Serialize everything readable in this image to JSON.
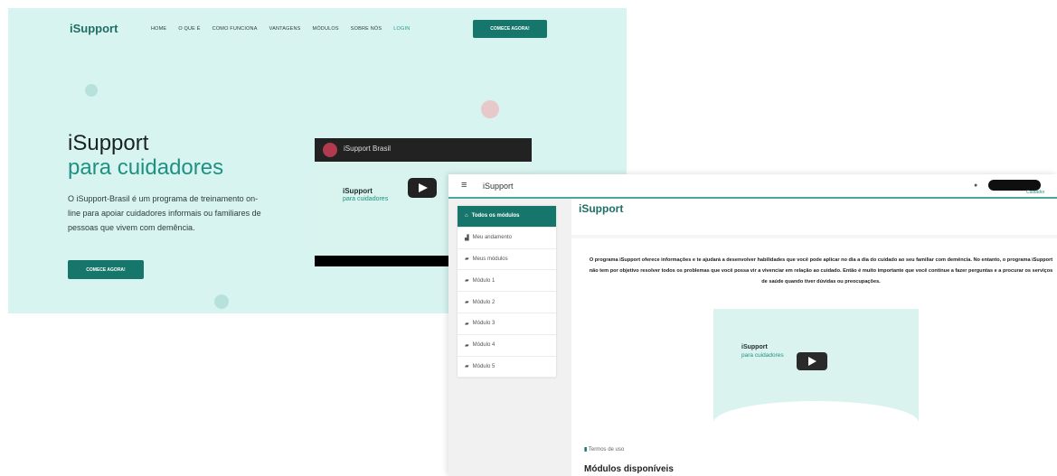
{
  "landing": {
    "logo": "iSupport",
    "nav": [
      "HOME",
      "O QUE É",
      "COMO FUNCIONA",
      "VANTAGENS",
      "MÓDULOS",
      "SOBRE NÓS",
      "LOGIN"
    ],
    "nav_cta": "COMECE AGORA!",
    "title_line1": "iSupport",
    "title_line2": "para cuidadores",
    "description": "O iSupport-Brasil é um programa de treinamento on-line para apoiar cuidadores informais ou familiares de pessoas que vivem com demência.",
    "cta": "COMECE AGORA!",
    "video": {
      "title": "iSupport Brasil",
      "logo": "iSupport",
      "subtitle": "para cuidadores"
    },
    "colors": {
      "background": "#d8f4f1",
      "accent": "#17766b",
      "accent_text": "#1f9183"
    }
  },
  "app": {
    "menu_icon": "hamburger-icon",
    "name": "iSupport",
    "user_icon": "user-icon",
    "user_role": "Cuidador",
    "sidebar": [
      {
        "label": "Todos os módulos",
        "icon": "home-icon",
        "active": true
      },
      {
        "label": "Meu andamento",
        "icon": "chart-icon",
        "active": false
      },
      {
        "label": "Meus módulos",
        "icon": "graduation-cap-icon",
        "active": false
      },
      {
        "label": "Módulo 1",
        "icon": "graduation-cap-icon",
        "active": false
      },
      {
        "label": "Módulo 2",
        "icon": "graduation-cap-icon",
        "active": false
      },
      {
        "label": "Módulo 3",
        "icon": "graduation-cap-icon",
        "active": false
      },
      {
        "label": "Módulo 4",
        "icon": "graduation-cap-icon",
        "active": false
      },
      {
        "label": "Módulo 5",
        "icon": "graduation-cap-icon",
        "active": false
      }
    ],
    "content_title": "iSupport",
    "intro": "O programa iSupport oferece informações e te ajudará a desenvolver habilidades que você pode aplicar no dia a dia do cuidado ao seu familiar com demência. No entanto, o programa iSupport não tem por objetivo resolver todos os problemas que você possa vir a vivenciar em relação ao cuidado. Então é muito importante que você continue a fazer perguntas e a procurar os serviços de saúde quando tiver dúvidas ou preocupações.",
    "preview": {
      "logo": "iSupport",
      "subtitle": "para cuidadores"
    },
    "terms": "Termos de uso",
    "section_heading": "Módulos disponíveis"
  }
}
